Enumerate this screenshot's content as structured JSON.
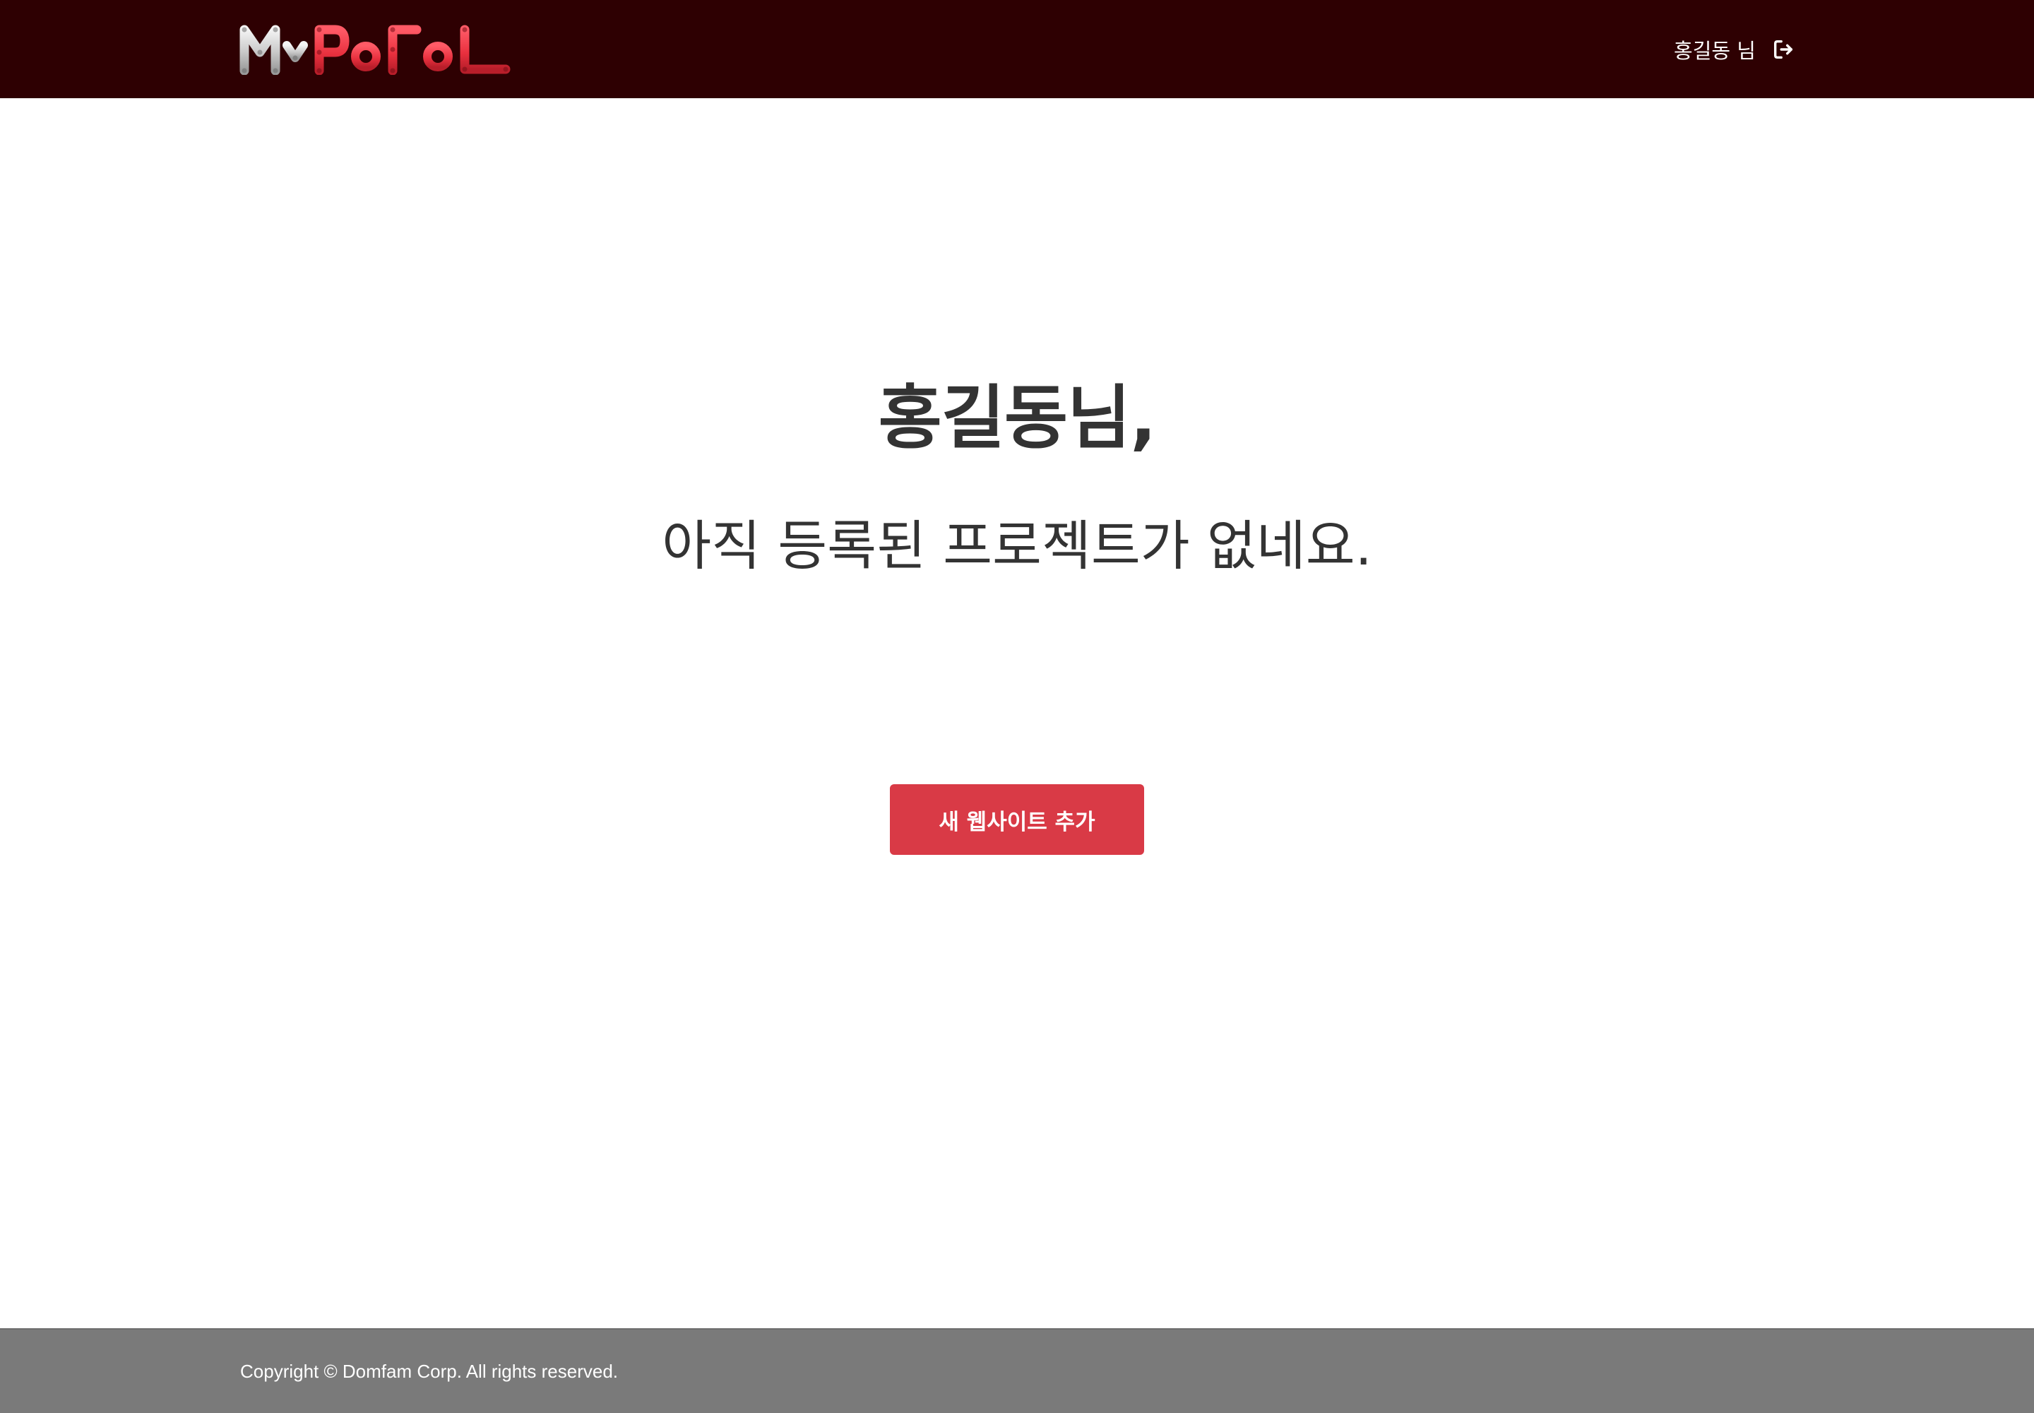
{
  "brand": {
    "logo_text": "MyPoFoL",
    "logo_part_1": "My",
    "logo_part_2": "PoFoL"
  },
  "header": {
    "user_name": "홍길동 님",
    "logout_icon": "sign-out-icon"
  },
  "main": {
    "greeting": "홍길동님,",
    "empty_message": "아직 등록된 프로젝트가 없네요.",
    "add_button_label": "새 웹사이트 추가"
  },
  "footer": {
    "copyright": "Copyright © Domfam Corp. All rights reserved."
  },
  "colors": {
    "header_bg": "#2e0002",
    "accent": "#d93a46",
    "logo_red": "#e8303e",
    "text_dark": "#333333",
    "footer_bg": "#7a7a7a"
  }
}
